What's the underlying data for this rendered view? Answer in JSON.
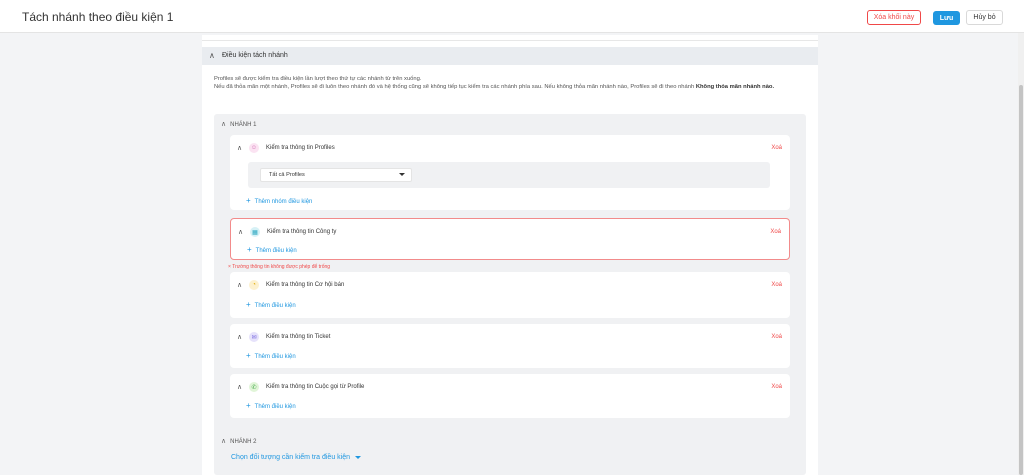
{
  "header": {
    "title": "Tách nhánh theo điều kiện 1",
    "delete_label": "Xóa khối này",
    "save_label": "Lưu",
    "cancel_label": "Hủy bỏ"
  },
  "section": {
    "title": "Điều kiện tách nhánh",
    "desc_line1": "Profiles sẽ được kiểm tra điều kiện lần lượt theo thứ tự các nhánh từ trên xuống.",
    "desc_line2": "Nếu đã thỏa mãn một nhánh, Profiles sẽ đi luôn theo nhánh đó và hệ thống cũng sẽ không tiếp tục kiểm tra các nhánh phía sau. Nếu không thỏa mãn nhánh nào, Profiles sẽ đi theo nhánh",
    "desc_bold": "Không thỏa mãn nhánh nào."
  },
  "branch1": {
    "title": "NHÁNH 1",
    "cards": [
      {
        "title": "Kiểm tra thông tin Profiles",
        "icon": "profile-icon",
        "color": "#fbe3f2",
        "glyph": "☺",
        "delete": "Xoá",
        "add": "Thêm nhóm điều kiện",
        "select": "Tất cả Profiles"
      },
      {
        "title": "Kiểm tra thông tin Công ty",
        "icon": "company-icon",
        "color": "#d6f1f6",
        "glyph": "▦",
        "delete": "Xoá",
        "add": "Thêm điều kiện",
        "error": "Trường thông tin không được phép để trống"
      },
      {
        "title": "Kiểm tra thông tin Cơ hội bán",
        "icon": "opportunity-icon",
        "color": "#fdf1cf",
        "glyph": "◔",
        "delete": "Xoá",
        "add": "Thêm điều kiện"
      },
      {
        "title": "Kiểm tra thông tin Ticket",
        "icon": "ticket-icon",
        "color": "#e6e2fb",
        "glyph": "✉",
        "delete": "Xoá",
        "add": "Thêm điều kiện"
      },
      {
        "title": "Kiểm tra thông tin Cuộc gọi từ Profile",
        "icon": "phone-icon",
        "color": "#e1f5d8",
        "glyph": "✆",
        "delete": "Xoá",
        "add": "Thêm điều kiện"
      }
    ]
  },
  "branch2": {
    "title": "NHÁNH 2",
    "choose": "Chọn đối tượng cần kiểm tra điều kiện"
  }
}
